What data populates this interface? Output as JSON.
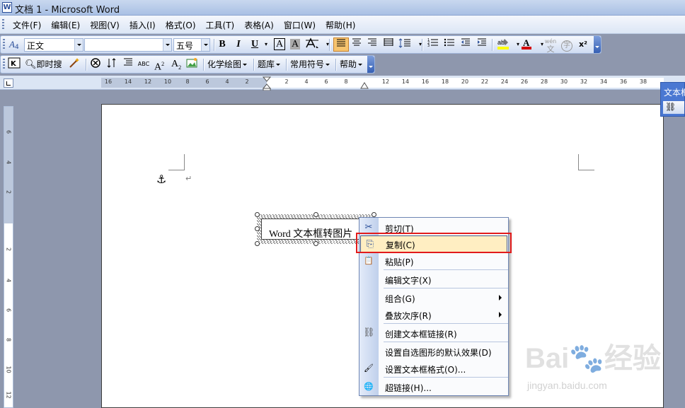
{
  "window": {
    "title": "文档 1 - Microsoft Word",
    "app_icon": "W"
  },
  "menubar": {
    "items": [
      "文件(F)",
      "编辑(E)",
      "视图(V)",
      "插入(I)",
      "格式(O)",
      "工具(T)",
      "表格(A)",
      "窗口(W)",
      "帮助(H)"
    ]
  },
  "toolbar1": {
    "style_value": "正文",
    "font_value": "",
    "size_value": "五号",
    "bold": "B",
    "italic": "I",
    "underline": "U",
    "char_border": "A",
    "char_shading": "A",
    "superscript_label": "x²",
    "wen_label": "wén",
    "yin_label": "字"
  },
  "toolbar2": {
    "search_label": "即时搜",
    "chem_label": "化学绘图",
    "tiku_label": "题库",
    "symbol_label": "常用符号",
    "help_label": "帮助",
    "abc_label": "ABC",
    "a2_label": "A",
    "a_sub_label": "A"
  },
  "ruler": {
    "left_numbers": [
      "16",
      "14",
      "12",
      "10",
      "8",
      "6",
      "4",
      "2"
    ],
    "right_numbers": [
      "2",
      "4",
      "6",
      "8",
      "12",
      "14",
      "16",
      "18",
      "20",
      "22",
      "24",
      "26",
      "28",
      "30",
      "32",
      "34",
      "36",
      "38"
    ],
    "vertical_numbers": [
      "6",
      "4",
      "2",
      "2",
      "4",
      "6",
      "8",
      "10",
      "12",
      "14"
    ]
  },
  "document": {
    "textbox_text": "Word 文本框转图片",
    "para_mark": "↵",
    "anchor": "⚓"
  },
  "context_menu": {
    "items": [
      {
        "label": "剪切(T)",
        "icon": "scissors-icon",
        "glyph": "✂"
      },
      {
        "label": "复制(C)",
        "icon": "copy-icon",
        "glyph": "⎘"
      },
      {
        "label": "粘贴(P)",
        "icon": "paste-icon",
        "glyph": "📋"
      },
      {
        "label": "编辑文字(X)",
        "icon": "",
        "glyph": ""
      },
      {
        "label": "组合(G)",
        "icon": "",
        "glyph": ""
      },
      {
        "label": "叠放次序(R)",
        "icon": "",
        "glyph": ""
      },
      {
        "label": "创建文本框链接(R)",
        "icon": "link-icon",
        "glyph": "⛓"
      },
      {
        "label": "设置自选图形的默认效果(D)",
        "icon": "",
        "glyph": ""
      },
      {
        "label": "设置文本框格式(O)...",
        "icon": "format-icon",
        "glyph": "🖌"
      },
      {
        "label": "超链接(H)...",
        "icon": "hyperlink-icon",
        "glyph": "🌐"
      }
    ],
    "highlighted": "复制(C)"
  },
  "float_toolbar": {
    "title": "文本框"
  },
  "watermark": {
    "brand": "Bai🐾经验",
    "url": "jingyan.baidu.com"
  },
  "colors": {
    "highlight_fill": "#ffeec2",
    "annotation_red": "#e21b1b",
    "font_color_red": "#d40000",
    "highlighter_yellow": "#ffff00"
  }
}
